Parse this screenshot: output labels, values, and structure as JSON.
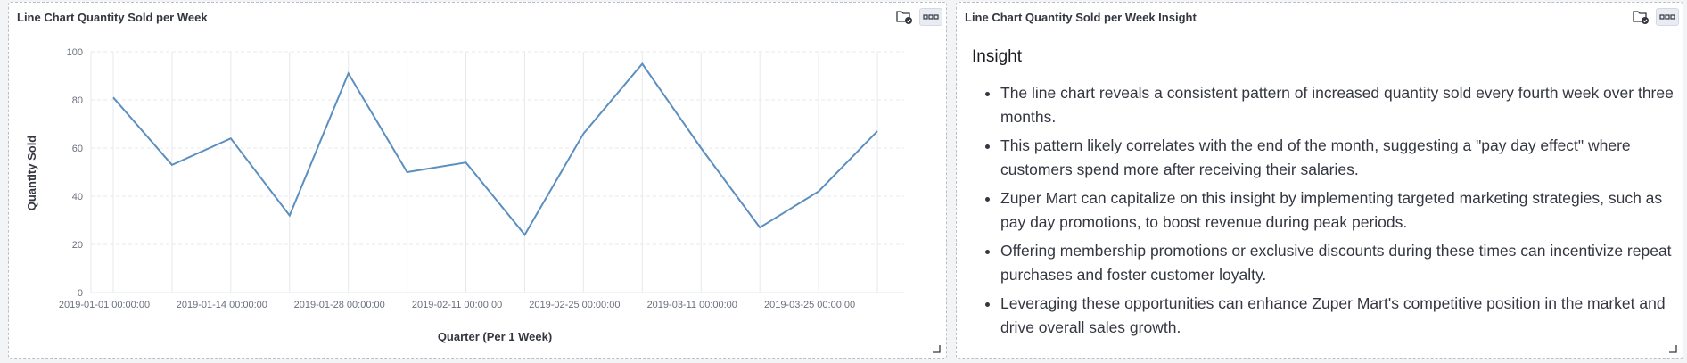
{
  "chart_panel": {
    "title": "Line Chart Quantity Sold per Week"
  },
  "insight_panel": {
    "title": "Line Chart Quantity Sold per Week Insight",
    "heading": "Insight",
    "bullets": [
      "The line chart reveals a consistent pattern of increased quantity sold every fourth week over three months.",
      "This pattern likely correlates with the end of the month, suggesting a \"pay day effect\" where customers spend more after receiving their salaries.",
      "Zuper Mart can capitalize on this insight by implementing targeted marketing strategies, such as pay day promotions, to boost revenue during peak periods.",
      "Offering membership promotions or exclusive discounts during these times can incentivize repeat purchases and foster customer loyalty.",
      "Leveraging these opportunities can enhance Zuper Mart's competitive position in the market and drive overall sales growth."
    ]
  },
  "icons": {
    "save": "folder-check-icon",
    "menu": "ellipsis-icon",
    "resize": "resize-corner-icon"
  },
  "colors": {
    "line": "#5b8fbf",
    "grid": "#e6e9ee",
    "axis_text": "#69707d"
  },
  "chart_data": {
    "type": "line",
    "title": "",
    "xlabel": "Quarter (Per 1 Week)",
    "ylabel": "Quantity Sold",
    "ylim": [
      0,
      100
    ],
    "yticks": [
      0,
      20,
      40,
      60,
      80,
      100
    ],
    "x": [
      "2019-01-01 00:00:00",
      "2019-01-07 00:00:00",
      "2019-01-14 00:00:00",
      "2019-01-21 00:00:00",
      "2019-01-28 00:00:00",
      "2019-02-04 00:00:00",
      "2019-02-11 00:00:00",
      "2019-02-18 00:00:00",
      "2019-02-25 00:00:00",
      "2019-03-04 00:00:00",
      "2019-03-11 00:00:00",
      "2019-03-18 00:00:00",
      "2019-03-25 00:00:00",
      "2019-04-01 00:00:00"
    ],
    "xtick_labels": [
      "2019-01-01 00:00:00",
      "2019-01-14 00:00:00",
      "2019-01-28 00:00:00",
      "2019-02-11 00:00:00",
      "2019-02-25 00:00:00",
      "2019-03-11 00:00:00",
      "2019-03-25 00:00:00"
    ],
    "series": [
      {
        "values": [
          81,
          53,
          64,
          32,
          91,
          50,
          54,
          24,
          66,
          95,
          60,
          27,
          42,
          67
        ]
      }
    ],
    "grid": true,
    "legend": "none"
  }
}
